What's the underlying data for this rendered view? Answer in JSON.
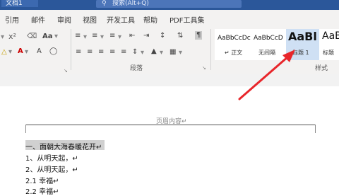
{
  "titlebar": {
    "doc_title": "文档1",
    "search_icon": "search-icon",
    "search_text": "搜索(Alt+Q)"
  },
  "tabs": [
    "引用",
    "邮件",
    "审阅",
    "视图",
    "开发工具",
    "帮助",
    "PDF工具集"
  ],
  "ribbon": {
    "paragraph_label": "段落",
    "styles_label": "样式",
    "styles": [
      {
        "sample": "AaBbCcDc",
        "name": "↵ 正文"
      },
      {
        "sample": "AaBbCcD",
        "name": "无间隔"
      },
      {
        "sample": "AaBl",
        "name": "标题 1"
      },
      {
        "sample": "AaB",
        "name": "标题"
      }
    ]
  },
  "document": {
    "header_text": "页眉内容↵",
    "lines": [
      "一、面朝大海春暖花开↵",
      "1、从明天起，↵",
      "2、从明天起，↵",
      "2.1 幸福↵",
      "2.2 幸福↵"
    ]
  },
  "colors": {
    "titlebar": "#2b579a",
    "annotation_arrow": "#e8262b",
    "ribbon_bg": "#f3f2f1"
  }
}
